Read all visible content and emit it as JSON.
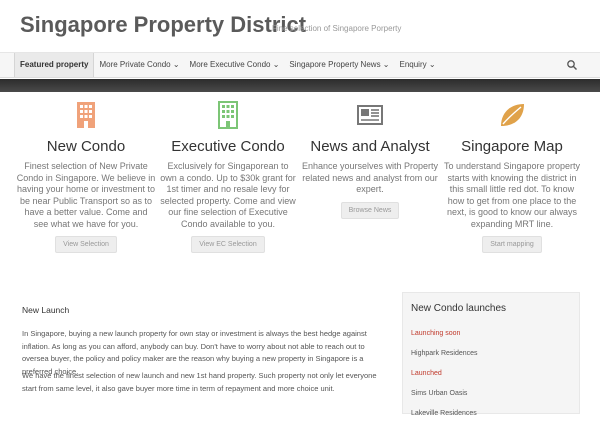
{
  "header": {
    "site_title": "Singapore Property District",
    "tagline": "Fine selection of Singapore Porperty"
  },
  "nav": {
    "items": [
      {
        "label": "Featured property"
      },
      {
        "label": "More Private Condo ⌄"
      },
      {
        "label": "More Executive Condo ⌄"
      },
      {
        "label": "Singapore Property News ⌄"
      },
      {
        "label": "Enquiry ⌄"
      }
    ],
    "search_icon": "search-icon"
  },
  "features": [
    {
      "icon": "building-icon",
      "color": "#f0a27a",
      "title": "New Condo",
      "text": "Finest selection of New Private Condo in Singapore. We believe in having your home or investment to be near Public Transport so as to have a better value. Come and see what we have for you.",
      "button": "View Selection"
    },
    {
      "icon": "building-icon",
      "color": "#7cc576",
      "title": "Executive Condo",
      "text": "Exclusively for Singaporean to own a condo. Up to $30k grant for 1st timer and no resale levy for selected property. Come and view our fine selection of Executive Condo available to you.",
      "button": "View EC Selection"
    },
    {
      "icon": "newspaper-icon",
      "color": "#777777",
      "title": "News and Analyst",
      "text": "Enhance yourselves with Property related news and analyst from our expert.",
      "button": "Browse News"
    },
    {
      "icon": "leaf-icon",
      "color": "#e0a24a",
      "title": "Singapore Map",
      "text": "To understand Singapore property starts with knowing the district in this small little red dot. To know how to get from one place to the next, is good to know our always expanding MRT line.",
      "button": "Start mapping"
    }
  ],
  "content": {
    "heading": "New Launch",
    "paragraphs": [
      "In Singapore, buying a new launch property for own stay or investment is always the best hedge against inflation. As long as you can afford, anybody can buy. Don't have to worry about not able to reach out to oversea buyer, the policy and policy maker are the reason why buying a new property in Singapore is a preferred choice.",
      "We have the finest selection of new launch and new 1st hand property. Such property not only let everyone start from same level, it also gave buyer more time in term of repayment and more choice unit."
    ]
  },
  "sidebar": {
    "title": "New Condo launches",
    "items": [
      {
        "label": "Launching soon",
        "status": "red"
      },
      {
        "label": "Highpark Residences",
        "status": "normal"
      },
      {
        "label": "Launched",
        "status": "red"
      },
      {
        "label": "Sims Urban Oasis",
        "status": "normal"
      },
      {
        "label": "Lakeville Residences",
        "status": "normal"
      }
    ]
  }
}
